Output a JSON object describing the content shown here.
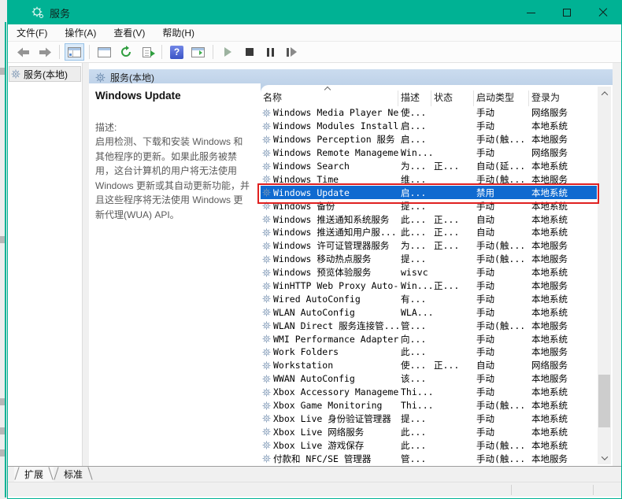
{
  "window": {
    "title": "服务"
  },
  "menu": {
    "items": [
      "文件(F)",
      "操作(A)",
      "查看(V)",
      "帮助(H)"
    ]
  },
  "toolbar": {
    "help_glyph": "?",
    "icons": [
      "back",
      "forward",
      "show-console-tree",
      "properties",
      "refresh",
      "export-list",
      "help",
      "show-action-pane",
      "start-service",
      "stop-service",
      "pause-service",
      "restart-service"
    ]
  },
  "tree": {
    "root_label": "服务(本地)"
  },
  "main": {
    "header_label": "服务(本地)",
    "description": {
      "service_title": "Windows Update",
      "label": "描述:",
      "body": "启用检测、下载和安装 Windows 和其他程序的更新。如果此服务被禁用，这台计算机的用户将无法使用 Windows 更新或其自动更新功能，并且这些程序将无法使用 Windows 更新代理(WUA) API。"
    },
    "table": {
      "columns": [
        "名称",
        "描述",
        "状态",
        "启动类型",
        "登录为"
      ],
      "selected_row_index": 6,
      "rows": [
        [
          "Windows Media Player Ne...",
          "使...",
          "",
          "手动",
          "网络服务"
        ],
        [
          "Windows Modules Installer",
          "启...",
          "",
          "手动",
          "本地系统"
        ],
        [
          "Windows Perception 服务",
          "启...",
          "",
          "手动(触...",
          "本地服务"
        ],
        [
          "Windows Remote Manageme...",
          "Win...",
          "",
          "手动",
          "网络服务"
        ],
        [
          "Windows Search",
          "为...",
          "正...",
          "自动(延...",
          "本地系统"
        ],
        [
          "Windows Time",
          "维...",
          "",
          "手动(触...",
          "本地服务"
        ],
        [
          "Windows Update",
          "启...",
          "",
          "禁用",
          "本地系统"
        ],
        [
          "Windows 备份",
          "提...",
          "",
          "手动",
          "本地系统"
        ],
        [
          "Windows 推送通知系统服务",
          "此...",
          "正...",
          "自动",
          "本地系统"
        ],
        [
          "Windows 推送通知用户服...",
          "此...",
          "正...",
          "自动",
          "本地系统"
        ],
        [
          "Windows 许可证管理器服务",
          "为...",
          "正...",
          "手动(触...",
          "本地服务"
        ],
        [
          "Windows 移动热点服务",
          "提...",
          "",
          "手动(触...",
          "本地服务"
        ],
        [
          "Windows 预览体验服务",
          "wisvc",
          "",
          "手动",
          "本地系统"
        ],
        [
          "WinHTTP Web Proxy Auto-...",
          "Win...",
          "正...",
          "手动",
          "本地服务"
        ],
        [
          "Wired AutoConfig",
          "有...",
          "",
          "手动",
          "本地系统"
        ],
        [
          "WLAN AutoConfig",
          "WLA...",
          "",
          "手动",
          "本地系统"
        ],
        [
          "WLAN Direct 服务连接管...",
          "管...",
          "",
          "手动(触...",
          "本地服务"
        ],
        [
          "WMI Performance Adapter",
          "向...",
          "",
          "手动",
          "本地系统"
        ],
        [
          "Work Folders",
          "此...",
          "",
          "手动",
          "本地服务"
        ],
        [
          "Workstation",
          "使...",
          "正...",
          "自动",
          "网络服务"
        ],
        [
          "WWAN AutoConfig",
          "该...",
          "",
          "手动",
          "本地服务"
        ],
        [
          "Xbox Accessory Manageme...",
          "Thi...",
          "",
          "手动",
          "本地系统"
        ],
        [
          "Xbox Game Monitoring",
          "Thi...",
          "",
          "手动(触...",
          "本地系统"
        ],
        [
          "Xbox Live 身份验证管理器",
          "提...",
          "",
          "手动",
          "本地系统"
        ],
        [
          "Xbox Live 网络服务",
          "此...",
          "",
          "手动",
          "本地系统"
        ],
        [
          "Xbox Live 游戏保存",
          "此...",
          "",
          "手动(触...",
          "本地系统"
        ],
        [
          "付款和 NFC/SE 管理器",
          "管...",
          "",
          "手动(触...",
          "本地服务"
        ]
      ]
    }
  },
  "tabs": [
    {
      "label": "扩展"
    },
    {
      "label": "标准"
    }
  ],
  "colors": {
    "titlebar": "#00b294",
    "selection": "#0f6ad0",
    "annotation": "#e02020"
  }
}
